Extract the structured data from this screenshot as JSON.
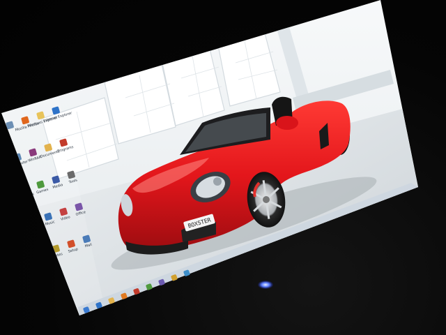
{
  "desktop": {
    "wallpaper": {
      "subject": "red-convertible-sports-car",
      "car_color": "#e3161b",
      "studio_color": "#eef2f4"
    },
    "license_plate": {
      "text": "BOXSTER"
    },
    "icons": [
      {
        "name": "recycle-bin-icon",
        "color": "#6d8fb4",
        "label": ""
      },
      {
        "name": "firefox-icon",
        "color": "#e0661c",
        "label": "Mozilla Firefox"
      },
      {
        "name": "folder-icon",
        "color": "#e8c35a",
        "label": "Windows Explorer"
      },
      {
        "name": "ie-icon",
        "color": "#2f73c8",
        "label": "Internet Explorer"
      },
      {
        "name": "computer-icon",
        "color": "#5d87b3",
        "label": "Computer"
      },
      {
        "name": "winrar-icon",
        "color": "#8a3a7c",
        "label": "WinRAR"
      },
      {
        "name": "folder-icon",
        "color": "#e2b24c",
        "label": "Documents"
      },
      {
        "name": "app-icon",
        "color": "#c23b2b",
        "label": "Programs"
      },
      {
        "name": "network-icon",
        "color": "#3d8ec9",
        "label": "Network"
      },
      {
        "name": "app-icon",
        "color": "#4f9a3e",
        "label": "Games"
      },
      {
        "name": "app-icon",
        "color": "#3b5aa6",
        "label": "Media"
      },
      {
        "name": "app-icon",
        "color": "#6b6b6b",
        "label": "Tools"
      },
      {
        "name": "app-icon",
        "color": "#d87f2a",
        "label": "Photos"
      },
      {
        "name": "app-icon",
        "color": "#3a72b7",
        "label": "Music"
      },
      {
        "name": "app-icon",
        "color": "#c44141",
        "label": "Video"
      },
      {
        "name": "app-icon",
        "color": "#7a55a8",
        "label": "Office"
      },
      {
        "name": "app-icon",
        "color": "#2f8f8a",
        "label": "Skype"
      },
      {
        "name": "app-icon",
        "color": "#b39a2c",
        "label": "Notes"
      },
      {
        "name": "app-icon",
        "color": "#d24f2a",
        "label": "Setup"
      },
      {
        "name": "app-icon",
        "color": "#4a7bb8",
        "label": "Mail"
      }
    ],
    "taskbar_icons": [
      {
        "name": "start-orb-icon",
        "color": "#3a7ad0"
      },
      {
        "name": "ie-icon",
        "color": "#2f73c8"
      },
      {
        "name": "folder-icon",
        "color": "#e2b24c"
      },
      {
        "name": "media-player-icon",
        "color": "#e07a22"
      },
      {
        "name": "app-icon",
        "color": "#c23b2b"
      },
      {
        "name": "app-icon",
        "color": "#4f9a3e"
      },
      {
        "name": "app-icon",
        "color": "#6b5ab0"
      },
      {
        "name": "app-icon",
        "color": "#d0a030"
      },
      {
        "name": "app-icon",
        "color": "#3d8ec9"
      }
    ]
  }
}
